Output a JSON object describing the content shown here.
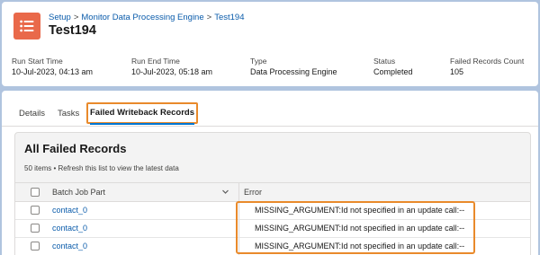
{
  "breadcrumb": {
    "items": [
      "Setup",
      "Monitor Data Processing Engine",
      "Test194"
    ],
    "separator": ">"
  },
  "record": {
    "title": "Test194",
    "icon": "list-icon",
    "icon_color": "#e9694a"
  },
  "highlights": [
    {
      "label": "Run Start Time",
      "value": "10-Jul-2023, 04:13 am"
    },
    {
      "label": "Run End Time",
      "value": "10-Jul-2023, 05:18 am"
    },
    {
      "label": "Type",
      "value": "Data Processing Engine"
    },
    {
      "label": "Status",
      "value": "Completed"
    },
    {
      "label": "Failed Records Count",
      "value": "105"
    }
  ],
  "tabs": [
    {
      "label": "Details"
    },
    {
      "label": "Tasks"
    },
    {
      "label": "Failed Writeback Records",
      "active": true
    }
  ],
  "list": {
    "title": "All Failed Records",
    "subtitle": "50 items • Refresh this list to view the latest data",
    "columns": [
      "Batch Job Part",
      "Error"
    ],
    "rows": [
      {
        "batch_job_part": "contact_0",
        "error": "MISSING_ARGUMENT:Id not specified in an update call:--"
      },
      {
        "batch_job_part": "contact_0",
        "error": "MISSING_ARGUMENT:Id not specified in an update call:--"
      },
      {
        "batch_job_part": "contact_0",
        "error": "MISSING_ARGUMENT:Id not specified in an update call:--"
      }
    ]
  },
  "colors": {
    "accent_link": "#0b5cab",
    "highlight_outline": "#e98a2b",
    "background": "#b0c4df"
  }
}
